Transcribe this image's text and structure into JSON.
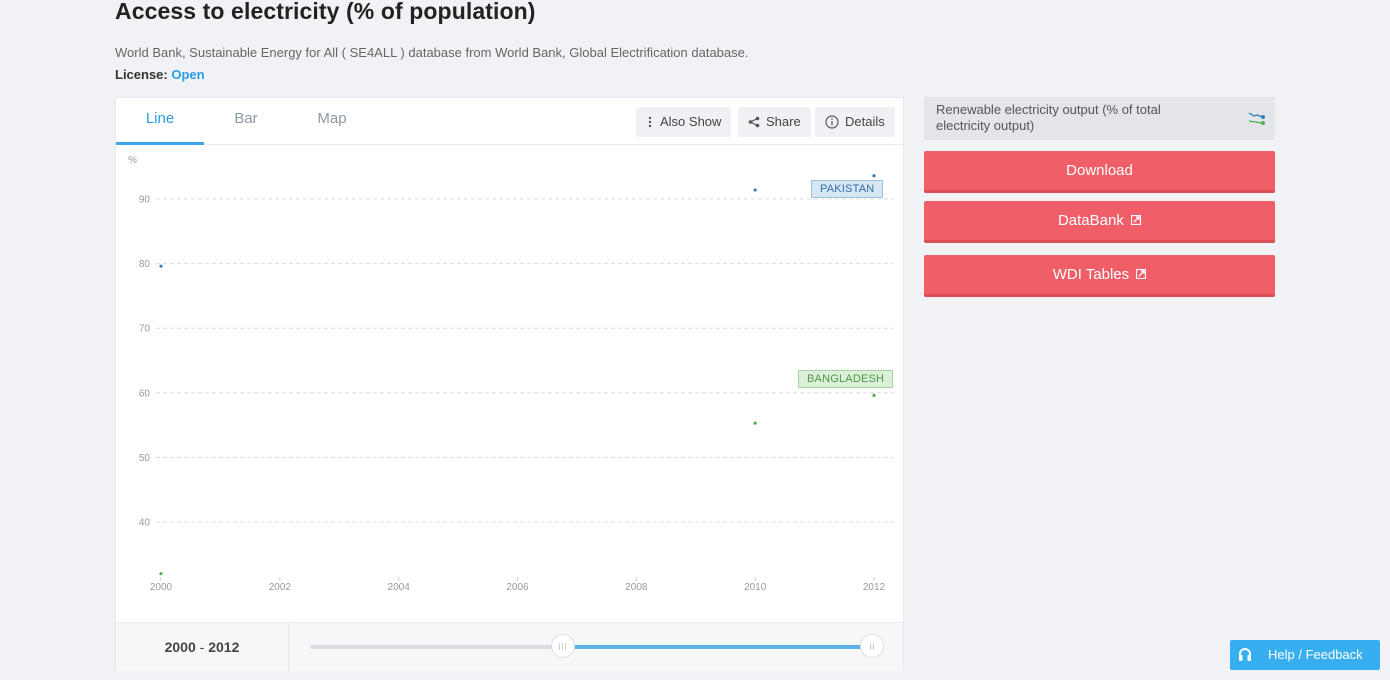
{
  "page": {
    "title": "Access to electricity (% of population)",
    "source": "World Bank, Sustainable Energy for All ( SE4ALL ) database from World Bank, Global Electrification database.",
    "license_label": "License:",
    "license_value": "Open"
  },
  "tabs": [
    {
      "label": "Line",
      "active": true
    },
    {
      "label": "Bar",
      "active": false
    },
    {
      "label": "Map",
      "active": false
    }
  ],
  "toolbar": {
    "also_show": "Also Show",
    "share": "Share",
    "details": "Details"
  },
  "range": {
    "start": "2000",
    "separator": " - ",
    "end": "2012",
    "slider_low_fraction": 0.45,
    "slider_high_fraction": 1.0
  },
  "sidebar": {
    "related_indicator": "Renewable electricity output (% of total electricity output)",
    "download": "Download",
    "databank": "DataBank",
    "wdi_tables": "WDI Tables"
  },
  "help": {
    "label": "Help / Feedback"
  },
  "colors": {
    "accent": "#2b9ce6",
    "pakistan": "#2f7fc1",
    "bangladesh": "#4caf50",
    "button_red": "#f05f68"
  },
  "chart_data": {
    "type": "scatter",
    "title": "Access to electricity (% of population)",
    "ylabel": "%",
    "xlabel": "",
    "x_ticks": [
      "2000",
      "2002",
      "2004",
      "2006",
      "2008",
      "2010",
      "2012"
    ],
    "y_ticks": [
      40,
      50,
      60,
      70,
      80,
      90
    ],
    "xlim": [
      2000,
      2012
    ],
    "ylim": [
      30,
      95
    ],
    "grid": true,
    "series": [
      {
        "name": "PAKISTAN",
        "color": "#2f7fc1",
        "points": [
          {
            "x": 2000,
            "y": 79.6
          },
          {
            "x": 2010,
            "y": 91.4
          },
          {
            "x": 2012,
            "y": 93.6
          }
        ]
      },
      {
        "name": "BANGLADESH",
        "color": "#4caf50",
        "points": [
          {
            "x": 2000,
            "y": 32.0
          },
          {
            "x": 2010,
            "y": 55.3
          },
          {
            "x": 2012,
            "y": 59.6
          }
        ]
      }
    ]
  }
}
